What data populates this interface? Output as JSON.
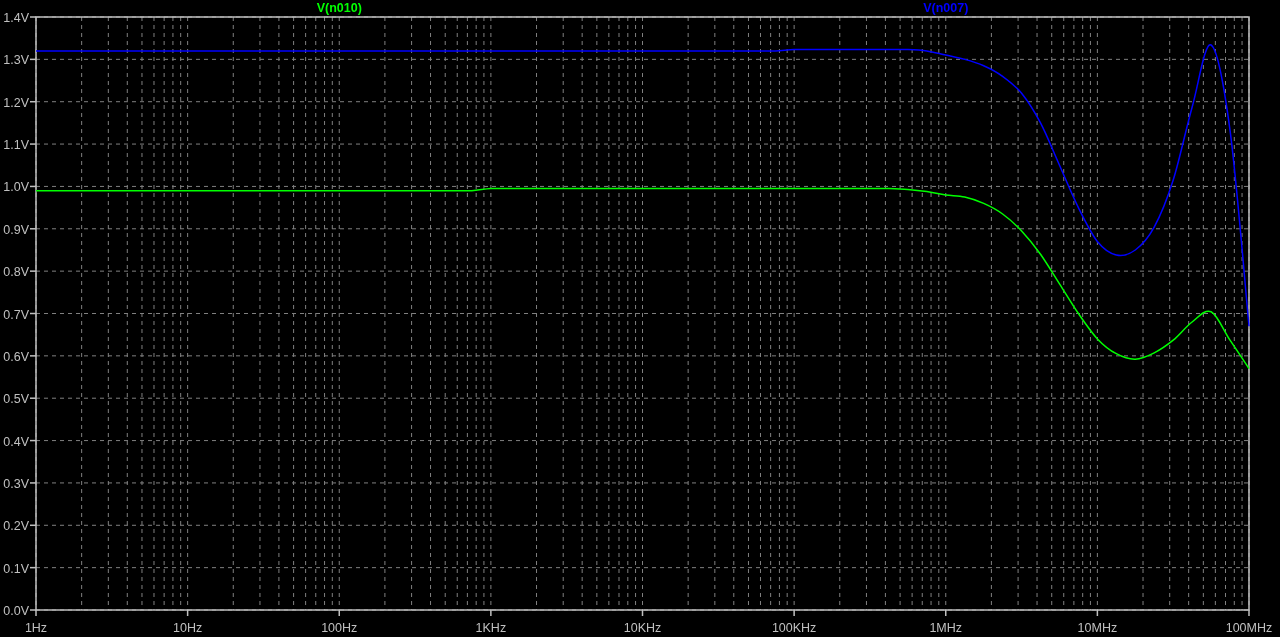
{
  "chart_data": {
    "type": "line",
    "grid": true,
    "categories": [
      "1Hz",
      null,
      null,
      null,
      null,
      null,
      null,
      null,
      "10Hz",
      null,
      null,
      null,
      null,
      null,
      null,
      null,
      "100Hz",
      null,
      null,
      null,
      null,
      null,
      null,
      null,
      "1KHz",
      null,
      null,
      null,
      null,
      null,
      null,
      null,
      "10KHz",
      null,
      null,
      null,
      null,
      null,
      null,
      null,
      "100KHz",
      null,
      null,
      null,
      null,
      null,
      null,
      null,
      "1MHz",
      null,
      null,
      null,
      null,
      null,
      null,
      null,
      "10MHz",
      null,
      null,
      null,
      null,
      null,
      null,
      null,
      "100MHz"
    ],
    "ylim": [
      0,
      1.4
    ],
    "yticks": [
      {
        "value": 0,
        "label": "0.0V"
      },
      {
        "value": 0.1,
        "label": "0.1V"
      },
      {
        "value": 0.2,
        "label": "0.2V"
      },
      {
        "value": 0.3,
        "label": "0.3V"
      },
      {
        "value": 0.4,
        "label": "0.4V"
      },
      {
        "value": 0.5,
        "label": "0.5V"
      },
      {
        "value": 0.6,
        "label": "0.6V"
      },
      {
        "value": 0.7,
        "label": "0.7V"
      },
      {
        "value": 0.8,
        "label": "0.8V"
      },
      {
        "value": 0.9,
        "label": "0.9V"
      },
      {
        "value": 1.0,
        "label": "1.0V"
      },
      {
        "value": 1.1,
        "label": "1.1V"
      },
      {
        "value": 1.2,
        "label": "1.2V"
      },
      {
        "value": 1.3,
        "label": "1.3V"
      },
      {
        "value": 1.4,
        "label": "1.4V"
      }
    ],
    "series": [
      {
        "name": "V(n010)",
        "color": "#00ff00",
        "values": [
          0.99,
          0.99,
          0.99,
          0.99,
          0.99,
          0.99,
          0.99,
          0.99,
          0.99,
          0.99,
          0.99,
          0.99,
          0.99,
          0.99,
          0.99,
          0.99,
          0.99,
          0.99,
          0.99,
          0.99,
          0.99,
          0.99,
          0.99,
          0.99,
          0.995,
          0.995,
          0.995,
          0.995,
          0.995,
          0.995,
          0.995,
          0.995,
          0.995,
          0.995,
          0.995,
          0.995,
          0.995,
          0.995,
          0.995,
          0.995,
          0.995,
          0.995,
          0.995,
          0.995,
          0.995,
          0.995,
          0.993,
          0.988,
          0.98,
          0.975,
          0.96,
          0.935,
          0.895,
          0.84,
          0.77,
          0.7,
          0.64,
          0.605,
          0.592,
          0.607,
          0.637,
          0.68,
          0.704,
          0.637,
          0.57
        ]
      },
      {
        "name": "V(n007)",
        "color": "#0000ff",
        "values": [
          1.32,
          1.32,
          1.32,
          1.32,
          1.32,
          1.32,
          1.32,
          1.32,
          1.32,
          1.32,
          1.32,
          1.32,
          1.32,
          1.32,
          1.32,
          1.32,
          1.32,
          1.32,
          1.32,
          1.32,
          1.32,
          1.32,
          1.32,
          1.32,
          1.32,
          1.32,
          1.32,
          1.32,
          1.32,
          1.32,
          1.32,
          1.32,
          1.32,
          1.32,
          1.32,
          1.32,
          1.32,
          1.32,
          1.32,
          1.32,
          1.323,
          1.323,
          1.323,
          1.323,
          1.323,
          1.323,
          1.323,
          1.32,
          1.31,
          1.3,
          1.285,
          1.26,
          1.22,
          1.15,
          1.05,
          0.95,
          0.87,
          0.838,
          0.85,
          0.904,
          1.015,
          1.187,
          1.334,
          1.133,
          0.67
        ]
      }
    ]
  }
}
